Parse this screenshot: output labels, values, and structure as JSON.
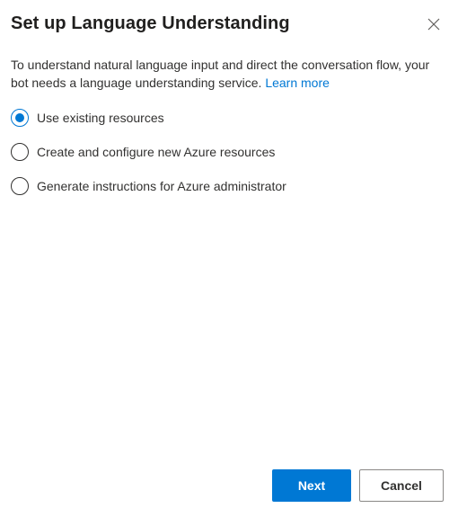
{
  "dialog": {
    "title": "Set up Language Understanding",
    "close_icon": "close-icon",
    "description": "To understand natural language input and direct the conversation flow, your bot needs a language understanding service.",
    "learn_more": "Learn more",
    "options": [
      {
        "label": "Use existing resources",
        "checked": true
      },
      {
        "label": "Create and configure new Azure resources",
        "checked": false
      },
      {
        "label": "Generate instructions for Azure administrator",
        "checked": false
      }
    ],
    "buttons": {
      "next": "Next",
      "cancel": "Cancel"
    }
  },
  "colors": {
    "accent": "#0078d4",
    "text": "#323130",
    "border": "#8a8886"
  }
}
